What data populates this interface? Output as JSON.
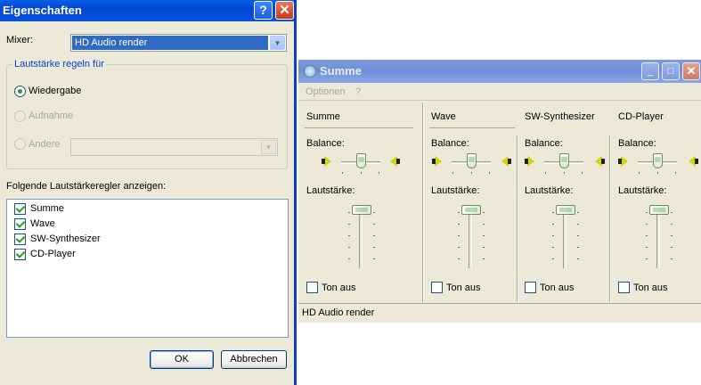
{
  "props": {
    "title": "Eigenschaften",
    "help_glyph": "?",
    "close_glyph": "✕",
    "mixer_label": "Mixer:",
    "mixer_value": "HD Audio render",
    "group_title": "Lautstärke regeln für",
    "radio_playback": "Wiedergabe",
    "radio_record": "Aufnahme",
    "radio_other": "Andere",
    "list_label": "Folgende Lautstärkeregler anzeigen:",
    "items": [
      "Summe",
      "Wave",
      "SW-Synthesizer",
      "CD-Player"
    ],
    "ok_label": "OK",
    "cancel_label": "Abbrechen"
  },
  "volume": {
    "title": "Summe",
    "menu_options": "Optionen",
    "menu_help": "?",
    "balance_label": "Balance:",
    "volume_label": "Lautstärke:",
    "mute_label": "Ton aus",
    "channels": [
      "Summe",
      "Wave",
      "SW-Synthesizer",
      "CD-Player"
    ],
    "status": "HD Audio render",
    "min_glyph": "_",
    "max_glyph": "□",
    "close_glyph": "✕"
  }
}
